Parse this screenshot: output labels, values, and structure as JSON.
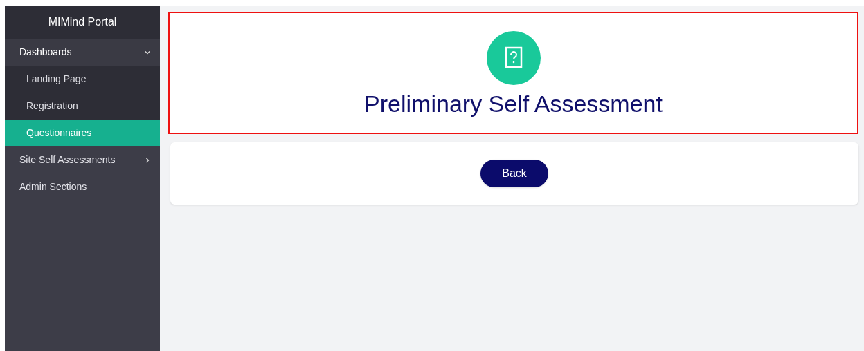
{
  "sidebar": {
    "title": "MIMind Portal",
    "items": [
      {
        "label": "Dashboards",
        "expanded": true,
        "selected": false,
        "children": [
          {
            "label": "Landing Page",
            "selected": false
          },
          {
            "label": "Registration",
            "selected": false
          },
          {
            "label": "Questionnaires",
            "selected": true
          }
        ]
      },
      {
        "label": "Site Self Assessments",
        "expanded": false,
        "selected": false
      },
      {
        "label": "Admin Sections",
        "selected": false
      }
    ]
  },
  "header": {
    "title": "Preliminary Self Assessment"
  },
  "actions": {
    "back_button": "Back"
  }
}
